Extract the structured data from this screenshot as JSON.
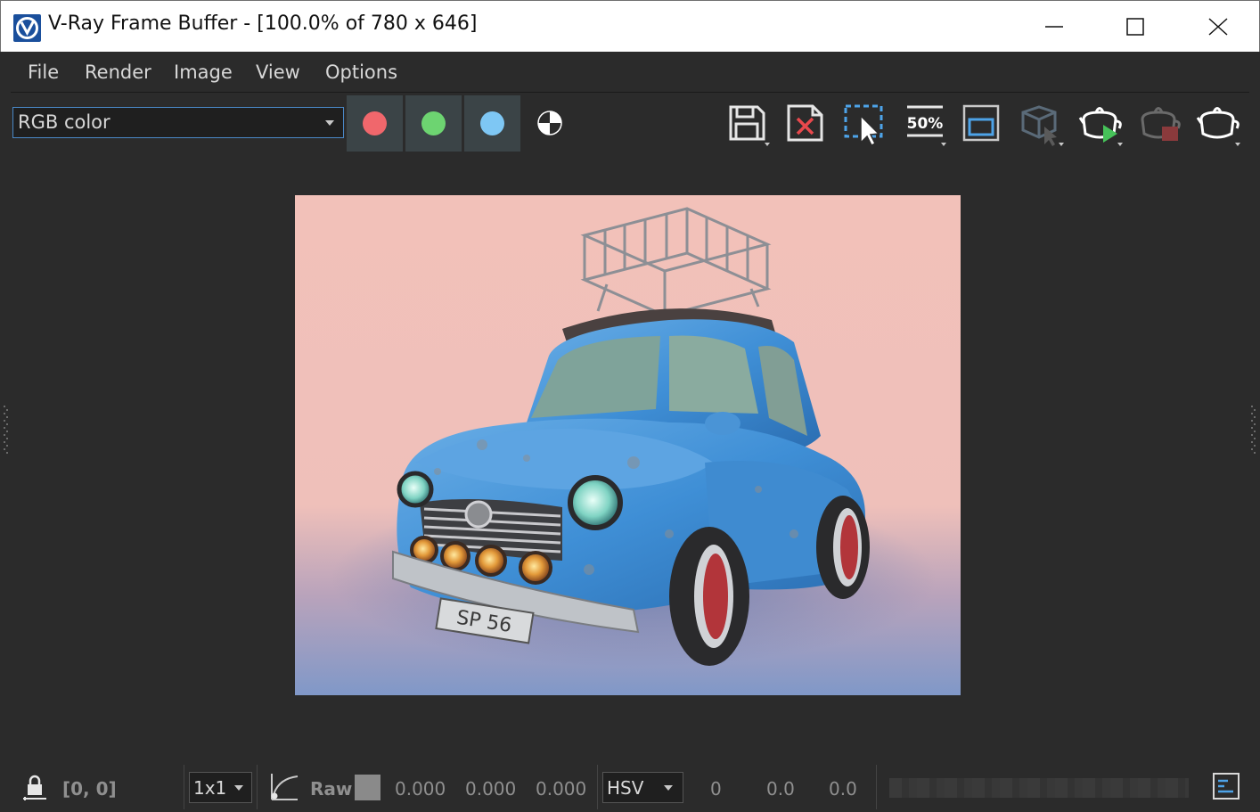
{
  "window": {
    "title": "V-Ray Frame Buffer - [100.0% of 780 x 646]",
    "logo_icon": "vray-logo-icon",
    "buttons": [
      "minimize-icon",
      "maximize-icon",
      "close-icon"
    ]
  },
  "menu": {
    "file": "File",
    "render": "Render",
    "image": "Image",
    "view": "View",
    "options": "Options"
  },
  "toolbar": {
    "channel": "RGB color",
    "channel_buttons": [
      {
        "name": "red-channel",
        "color": "#f0676c"
      },
      {
        "name": "green-channel",
        "color": "#6dd471"
      },
      {
        "name": "blue-channel",
        "color": "#7ec7f4"
      }
    ],
    "tools": [
      "save-image-icon",
      "clear-image-icon",
      "region-render-icon",
      "zoom-50-icon",
      "frame-icon",
      "track-mouse-icon",
      "render-interactive-icon",
      "stop-render-icon",
      "render-icon"
    ],
    "zoom_label": "50%"
  },
  "status": {
    "coords": "[0, 0]",
    "sampling": "1x1",
    "mode": "Raw",
    "r": "0.000",
    "g": "0.000",
    "b": "0.000",
    "colorspace": "HSV",
    "h": "0",
    "s": "0.0",
    "v": "0.0"
  },
  "colors": {
    "background": "#2b2b2b",
    "accent_border": "#4a88c7",
    "render_bg": "#f2c3bc",
    "car_body": "#4a94d6"
  },
  "render": {
    "plate_text": "SP 56"
  }
}
